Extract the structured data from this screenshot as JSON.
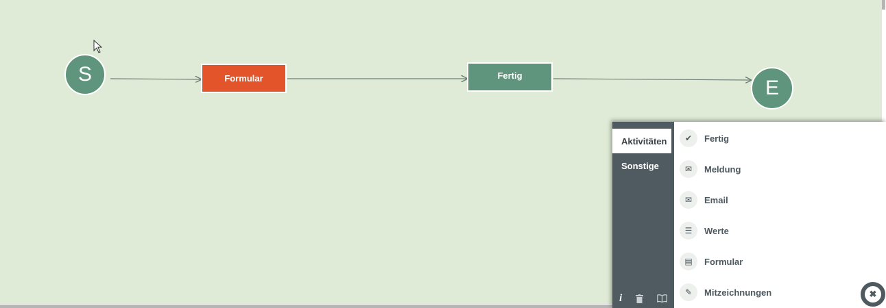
{
  "canvas": {
    "start_node_label": "S",
    "end_node_label": "E",
    "nodes": [
      {
        "label": "Formular",
        "color": "#e4542b"
      },
      {
        "label": "Fertig",
        "color": "#5e957c"
      }
    ]
  },
  "panel": {
    "tabs": [
      "Aktivitäten",
      "Sonstige"
    ],
    "items": [
      {
        "label": "Fertig",
        "icon": "check-icon"
      },
      {
        "label": "Meldung",
        "icon": "envelope-icon"
      },
      {
        "label": "Email",
        "icon": "envelope-icon"
      },
      {
        "label": "Werte",
        "icon": "list-icon"
      },
      {
        "label": "Formular",
        "icon": "document-icon"
      },
      {
        "label": "Mitzeichnungen",
        "icon": "signature-icon"
      }
    ],
    "footer_icons": [
      "info-icon",
      "trash-icon",
      "book-icon"
    ]
  }
}
